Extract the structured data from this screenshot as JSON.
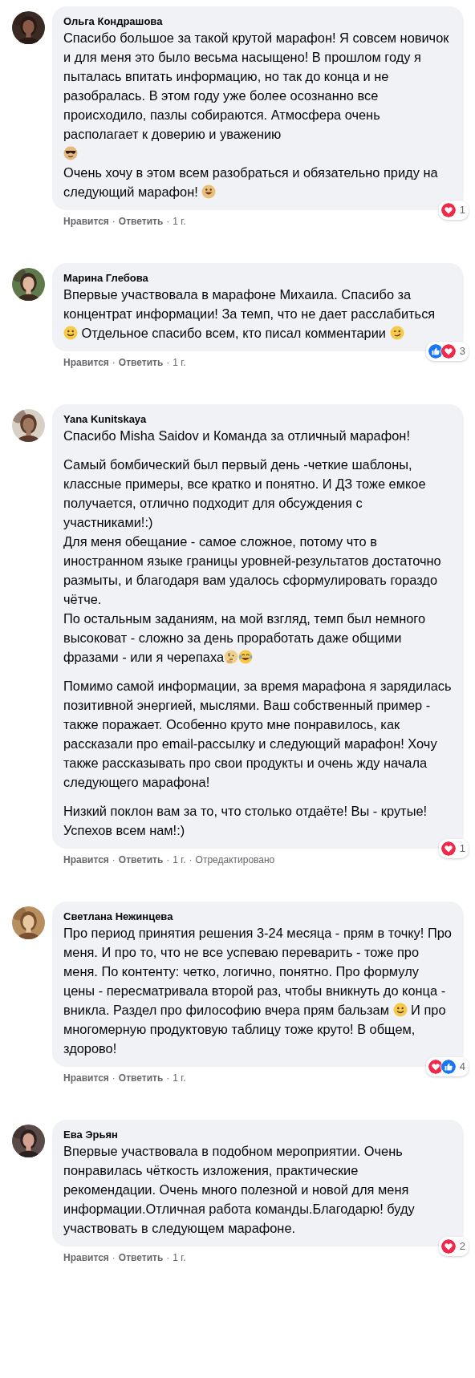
{
  "separator": "·",
  "comments": [
    {
      "author": "Ольга Кондрашова",
      "avatar": {
        "kind": "picture"
      },
      "paragraphs": [
        [
          {
            "kind": "text",
            "text": "Спасибо большое за такой крутой марафон! Я совсем новичок и для меня это было весьма насыщено! В прошлом году я пыталась впитать информацию, но так до конца и не разобралась. В этом году уже более осознанно все происходило, пазлы собираются. Атмосфера очень располагает к доверию и уважению\n"
          },
          {
            "kind": "sunglasses"
          },
          {
            "kind": "text",
            "text": "\nОчень хочу в этом всем разобраться и обязательно приду на следующий марафон! "
          },
          {
            "kind": "grin"
          }
        ]
      ],
      "reactions": {
        "icons": [
          {
            "kind": "love"
          }
        ],
        "count": "1"
      },
      "footer": [
        {
          "kind": "action",
          "text": "Нравится"
        },
        {
          "kind": "action",
          "text": "Ответить"
        },
        {
          "kind": "meta",
          "text": "1 г."
        }
      ]
    },
    {
      "author": "Марина Глебова",
      "avatar": {
        "kind": "picture"
      },
      "paragraphs": [
        [
          {
            "kind": "text",
            "text": "Впервые участвовала в марафоне Михаила. Спасибо за концентрат информации! За темп, что не дает расслабиться "
          },
          {
            "kind": "smile"
          },
          {
            "kind": "text",
            "text": " Отдельное спасибо всем, кто писал комментарии "
          },
          {
            "kind": "wink"
          }
        ]
      ],
      "reactions": {
        "icons": [
          {
            "kind": "like"
          },
          {
            "kind": "love"
          }
        ],
        "count": "3"
      },
      "footer": [
        {
          "kind": "action",
          "text": "Нравится"
        },
        {
          "kind": "action",
          "text": "Ответить"
        },
        {
          "kind": "meta",
          "text": "1 г."
        }
      ]
    },
    {
      "author": "Yana Kunitskaya",
      "avatar": {
        "kind": "picture"
      },
      "paragraphs": [
        [
          {
            "kind": "text",
            "text": "Спасибо Misha Saidov и Команда за отличный марафон!"
          }
        ],
        [
          {
            "kind": "text",
            "text": "Самый бомбический был первый день -четкие шаблоны, классные примеры, все кратко и понятно. И ДЗ тоже емкое получается, отлично подходит для обсуждения с участниками!:)\nДля меня обещание - самое сложное, потому что в иностранном языке границы уровней-результатов достаточно размыты, и благодаря вам удалось сформулировать гораздо чётче.\nПо остальным заданиям, на мой взгляд, темп был немного высоковат - сложно за день проработать даже общими фразами - или я черепаха"
          },
          {
            "kind": "thinking"
          },
          {
            "kind": "laughing"
          }
        ],
        [
          {
            "kind": "text",
            "text": "Помимо самой информации, за время марафона я зарядилась позитивной энергией, мыслями. Ваш собственный пример - также поражает. Особенно круто мне понравилось, как рассказали про email-рассылку и следующий марафон! Хочу также рассказывать про свои продукты и очень жду начала следующего марафона!"
          }
        ],
        [
          {
            "kind": "text",
            "text": "Низкий поклон вам за то, что столько отдаёте! Вы - крутые! Успехов всем нам!:)"
          }
        ]
      ],
      "reactions": {
        "icons": [
          {
            "kind": "love"
          }
        ],
        "count": "1"
      },
      "footer": [
        {
          "kind": "action",
          "text": "Нравится"
        },
        {
          "kind": "action",
          "text": "Ответить"
        },
        {
          "kind": "meta",
          "text": "1 г."
        },
        {
          "kind": "meta",
          "text": "Отредактировано"
        }
      ]
    },
    {
      "author": "Светлана Нежинцева",
      "avatar": {
        "kind": "picture"
      },
      "paragraphs": [
        [
          {
            "kind": "text",
            "text": "Про период принятия решения 3-24 месяца - прям в точку! Про меня. И про то, что не все успеваю переварить - тоже про меня. По контенту: четко, логично, понятно. Про формулу цены - пересматривала второй раз, чтобы вникнуть до конца - вникла. Раздел про философию вчера прям бальзам "
          },
          {
            "kind": "smile"
          },
          {
            "kind": "text",
            "text": " И про многомерную продуктовую таблицу тоже круто! В общем, здорово!"
          }
        ]
      ],
      "reactions": {
        "icons": [
          {
            "kind": "love"
          },
          {
            "kind": "like"
          }
        ],
        "count": "4"
      },
      "footer": [
        {
          "kind": "action",
          "text": "Нравится"
        },
        {
          "kind": "action",
          "text": "Ответить"
        },
        {
          "kind": "meta",
          "text": "1 г."
        }
      ]
    },
    {
      "author": "Ева Эрьян",
      "avatar": {
        "kind": "picture"
      },
      "paragraphs": [
        [
          {
            "kind": "text",
            "text": "Впервые участвовала в подобном мероприятии. Очень понравилась чёткость изложения, практические рекомендации. Очень много полезной и новой для меня информации.Отличная работа команды.Благодарю! буду участвовать в следующем марафоне."
          }
        ]
      ],
      "reactions": {
        "icons": [
          {
            "kind": "love"
          }
        ],
        "count": "2"
      },
      "footer": [
        {
          "kind": "action",
          "text": "Нравится"
        },
        {
          "kind": "action",
          "text": "Ответить"
        },
        {
          "kind": "meta",
          "text": "1 г."
        }
      ]
    }
  ]
}
